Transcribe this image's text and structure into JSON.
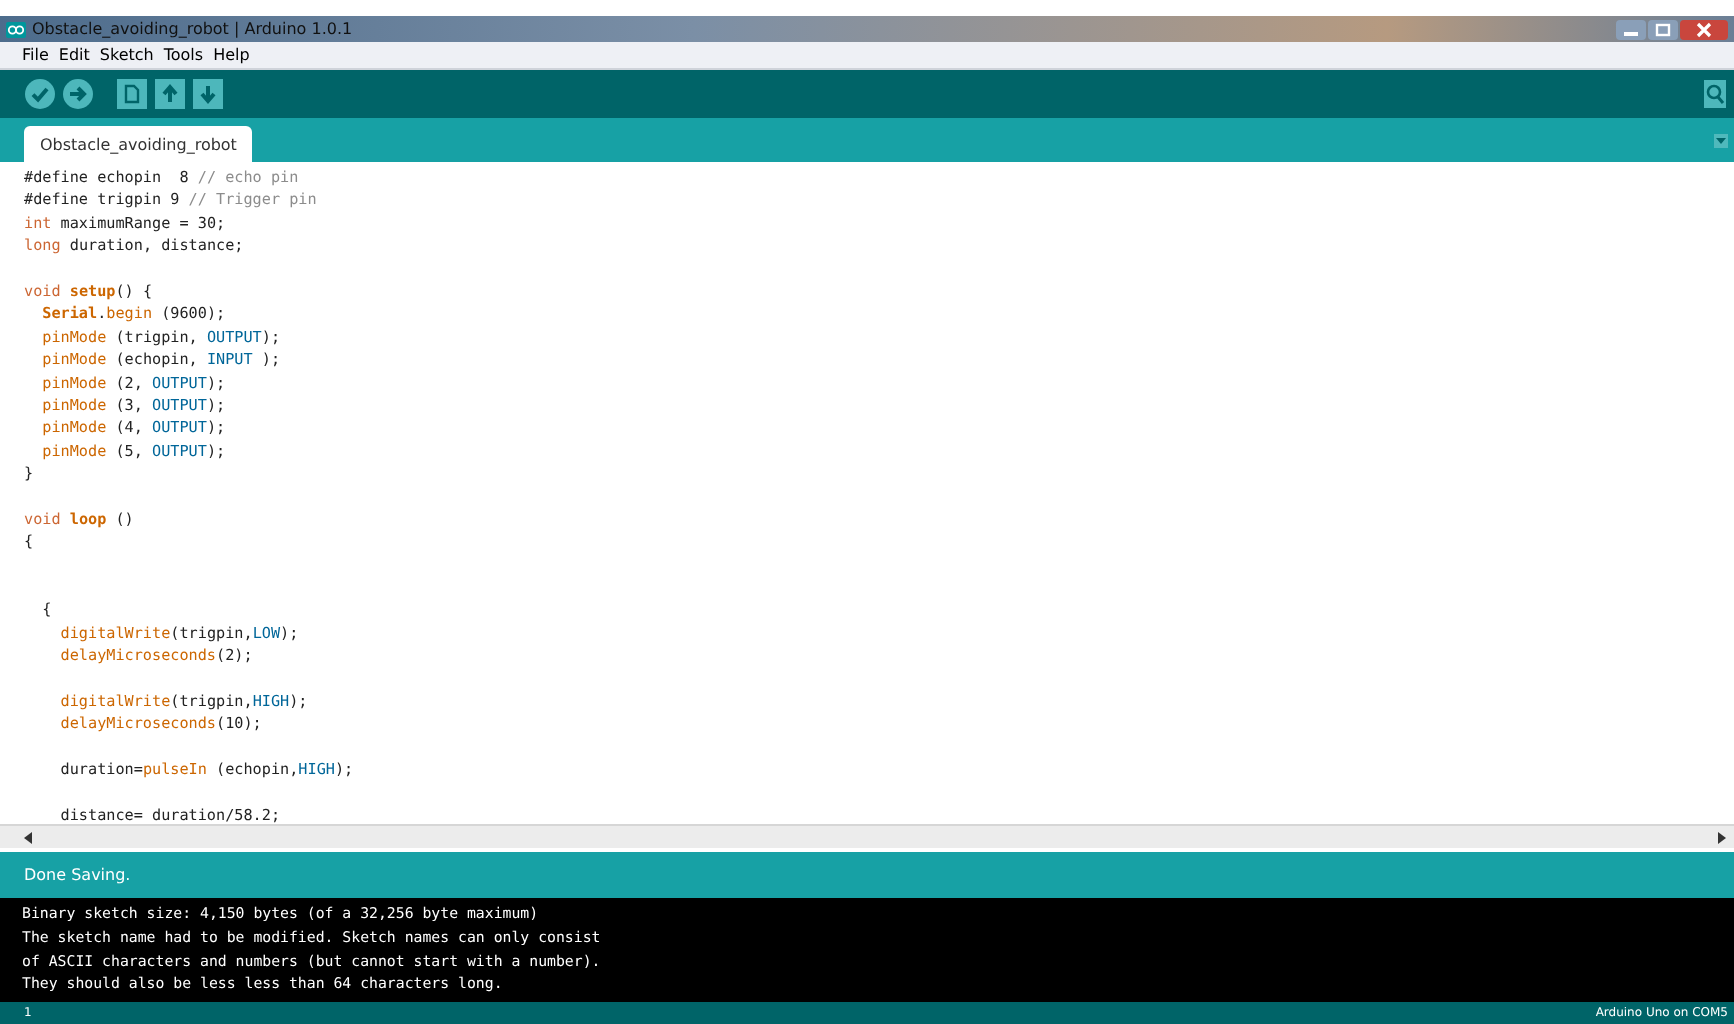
{
  "window": {
    "title": "Obstacle_avoiding_robot | Arduino 1.0.1"
  },
  "menu": [
    "File",
    "Edit",
    "Sketch",
    "Tools",
    "Help"
  ],
  "toolbar": [
    {
      "kind": "verify"
    },
    {
      "kind": "upload"
    },
    {
      "kind": "new"
    },
    {
      "kind": "open"
    },
    {
      "kind": "save"
    }
  ],
  "tabs": [
    {
      "label": "Obstacle_avoiding_robot",
      "selected": true
    }
  ],
  "code": [
    {
      "kind": "code",
      "tokens": [
        {
          "kind": "plain",
          "text": "#define echopin  8 "
        },
        {
          "kind": "comment",
          "text": "// echo pin"
        }
      ]
    },
    {
      "kind": "code",
      "tokens": [
        {
          "kind": "plain",
          "text": "#define trigpin 9 "
        },
        {
          "kind": "comment",
          "text": "// Trigger pin"
        }
      ]
    },
    {
      "kind": "code",
      "tokens": [
        {
          "kind": "type",
          "text": "int"
        },
        {
          "kind": "plain",
          "text": " maximumRange = 30;"
        }
      ]
    },
    {
      "kind": "code",
      "tokens": [
        {
          "kind": "type",
          "text": "long"
        },
        {
          "kind": "plain",
          "text": " duration, distance;"
        }
      ]
    },
    {
      "kind": "blank"
    },
    {
      "kind": "code",
      "tokens": [
        {
          "kind": "type",
          "text": "void"
        },
        {
          "kind": "bold",
          "text": " setup"
        },
        {
          "kind": "plain",
          "text": "() {"
        }
      ]
    },
    {
      "kind": "code",
      "tokens": [
        {
          "kind": "bold",
          "text": "  Serial"
        },
        {
          "kind": "plain",
          "text": "."
        },
        {
          "kind": "func",
          "text": "begin"
        },
        {
          "kind": "plain",
          "text": " (9600);"
        }
      ]
    },
    {
      "kind": "code",
      "tokens": [
        {
          "kind": "func",
          "text": "  pinMode"
        },
        {
          "kind": "plain",
          "text": " (trigpin, "
        },
        {
          "kind": "const",
          "text": "OUTPUT"
        },
        {
          "kind": "plain",
          "text": ");"
        }
      ]
    },
    {
      "kind": "code",
      "tokens": [
        {
          "kind": "func",
          "text": "  pinMode"
        },
        {
          "kind": "plain",
          "text": " (echopin, "
        },
        {
          "kind": "const",
          "text": "INPUT"
        },
        {
          "kind": "plain",
          "text": " );"
        }
      ]
    },
    {
      "kind": "code",
      "tokens": [
        {
          "kind": "func",
          "text": "  pinMode"
        },
        {
          "kind": "plain",
          "text": " (2, "
        },
        {
          "kind": "const",
          "text": "OUTPUT"
        },
        {
          "kind": "plain",
          "text": ");"
        }
      ]
    },
    {
      "kind": "code",
      "tokens": [
        {
          "kind": "func",
          "text": "  pinMode"
        },
        {
          "kind": "plain",
          "text": " (3, "
        },
        {
          "kind": "const",
          "text": "OUTPUT"
        },
        {
          "kind": "plain",
          "text": ");"
        }
      ]
    },
    {
      "kind": "code",
      "tokens": [
        {
          "kind": "func",
          "text": "  pinMode"
        },
        {
          "kind": "plain",
          "text": " (4, "
        },
        {
          "kind": "const",
          "text": "OUTPUT"
        },
        {
          "kind": "plain",
          "text": ");"
        }
      ]
    },
    {
      "kind": "code",
      "tokens": [
        {
          "kind": "func",
          "text": "  pinMode"
        },
        {
          "kind": "plain",
          "text": " (5, "
        },
        {
          "kind": "const",
          "text": "OUTPUT"
        },
        {
          "kind": "plain",
          "text": ");"
        }
      ]
    },
    {
      "kind": "code",
      "tokens": [
        {
          "kind": "plain",
          "text": "}"
        }
      ]
    },
    {
      "kind": "blank"
    },
    {
      "kind": "code",
      "tokens": [
        {
          "kind": "type",
          "text": "void"
        },
        {
          "kind": "bold",
          "text": " loop"
        },
        {
          "kind": "plain",
          "text": " ()"
        }
      ]
    },
    {
      "kind": "code",
      "tokens": [
        {
          "kind": "plain",
          "text": "{"
        }
      ]
    },
    {
      "kind": "blank"
    },
    {
      "kind": "blank"
    },
    {
      "kind": "code",
      "tokens": [
        {
          "kind": "plain",
          "text": "  {"
        }
      ]
    },
    {
      "kind": "code",
      "tokens": [
        {
          "kind": "func",
          "text": "    digitalWrite"
        },
        {
          "kind": "plain",
          "text": "(trigpin,"
        },
        {
          "kind": "const",
          "text": "LOW"
        },
        {
          "kind": "plain",
          "text": ");"
        }
      ]
    },
    {
      "kind": "code",
      "tokens": [
        {
          "kind": "func",
          "text": "    delayMicroseconds"
        },
        {
          "kind": "plain",
          "text": "(2);"
        }
      ]
    },
    {
      "kind": "blank"
    },
    {
      "kind": "code",
      "tokens": [
        {
          "kind": "func",
          "text": "    digitalWrite"
        },
        {
          "kind": "plain",
          "text": "(trigpin,"
        },
        {
          "kind": "const",
          "text": "HIGH"
        },
        {
          "kind": "plain",
          "text": ");"
        }
      ]
    },
    {
      "kind": "code",
      "tokens": [
        {
          "kind": "func",
          "text": "    delayMicroseconds"
        },
        {
          "kind": "plain",
          "text": "(10);"
        }
      ]
    },
    {
      "kind": "blank"
    },
    {
      "kind": "code",
      "tokens": [
        {
          "kind": "plain",
          "text": "    duration="
        },
        {
          "kind": "func",
          "text": "pulseIn"
        },
        {
          "kind": "plain",
          "text": " (echopin,"
        },
        {
          "kind": "const",
          "text": "HIGH"
        },
        {
          "kind": "plain",
          "text": ");"
        }
      ]
    },
    {
      "kind": "blank"
    },
    {
      "kind": "code",
      "tokens": [
        {
          "kind": "plain",
          "text": "    distance= duration/58.2;"
        }
      ]
    }
  ],
  "status": "Done Saving.",
  "console": [
    "Binary sketch size: 4,150 bytes (of a 32,256 byte maximum)",
    "The sketch name had to be modified. Sketch names can only consist",
    "of ASCII characters and numbers (but cannot start with a number).",
    "They should also be less less than 64 characters long."
  ],
  "footer": {
    "line": "1",
    "board": "Arduino Uno on COM5"
  }
}
